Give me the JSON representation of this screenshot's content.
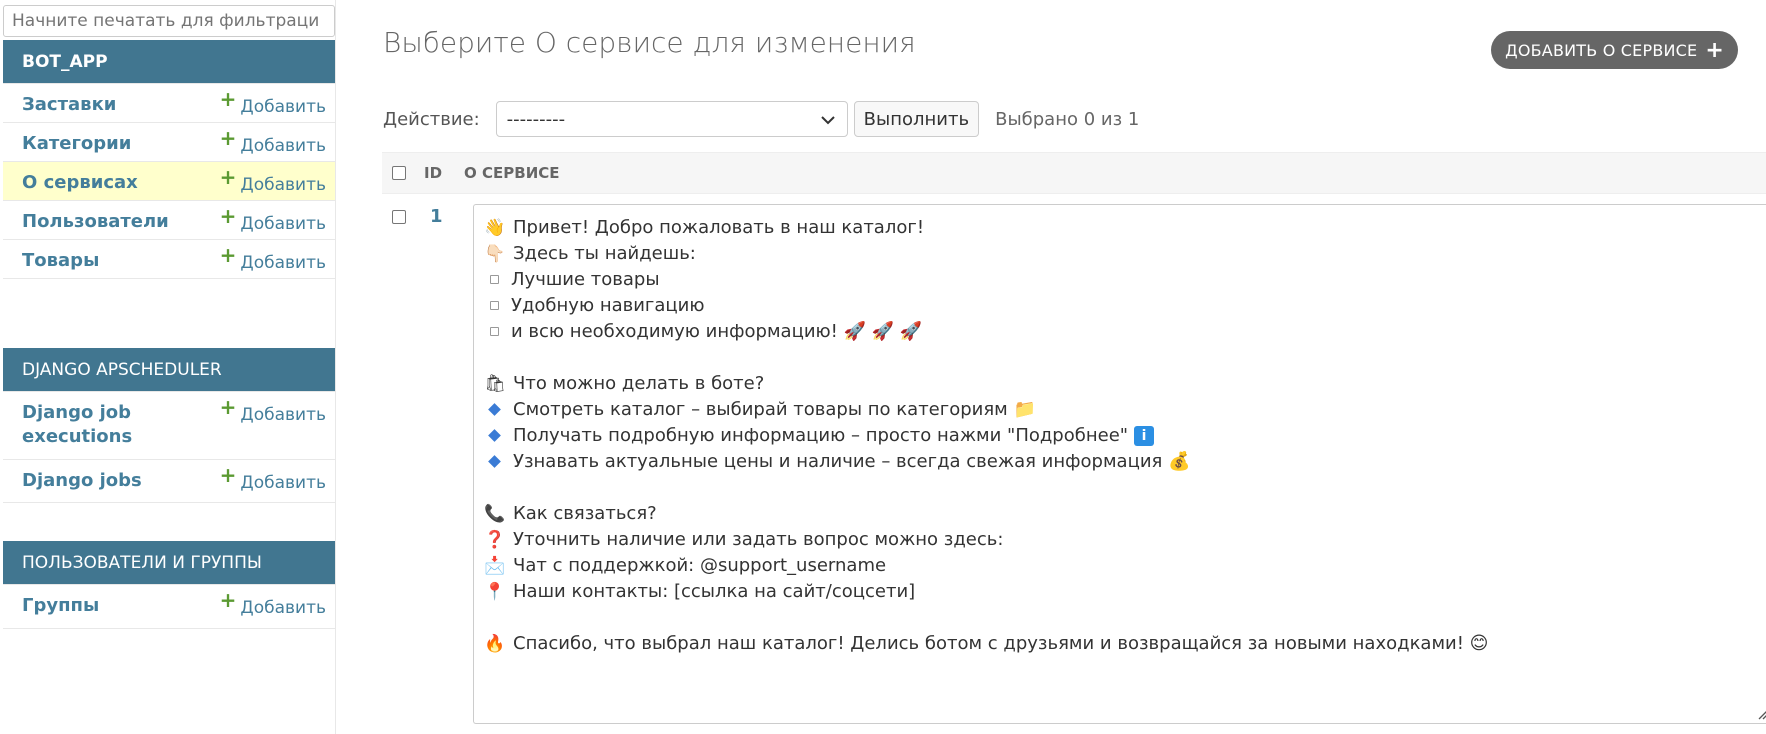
{
  "sidebar": {
    "filter_placeholder": "Начните печатать для фильтраци",
    "modules": [
      {
        "title": "BOT_APP",
        "rows": [
          {
            "name": "Заставки",
            "add": "Добавить"
          },
          {
            "name": "Категории",
            "add": "Добавить"
          },
          {
            "name": "О сервисах",
            "add": "Добавить",
            "current": true
          },
          {
            "name": "Пользователи",
            "add": "Добавить"
          },
          {
            "name": "Товары",
            "add": "Добавить"
          }
        ]
      },
      {
        "title": "DJANGO APSCHEDULER",
        "rows": [
          {
            "name": "Django job executions",
            "add": "Добавить"
          },
          {
            "name": "Django jobs",
            "add": "Добавить"
          }
        ]
      },
      {
        "title": "ПОЛЬЗОВАТЕЛИ И ГРУППЫ",
        "rows": [
          {
            "name": "Группы",
            "add": "Добавить"
          }
        ]
      }
    ]
  },
  "main": {
    "title": "Выберите О сервисе для изменения",
    "add_button": "ДОБАВИТЬ О СЕРВИСЕ",
    "actions": {
      "label": "Действие:",
      "selected_option": "---------",
      "go_label": "Выполнить",
      "selected_count": "Выбрано 0 из 1"
    },
    "table": {
      "columns": [
        "ID",
        "О СЕРВИСЕ"
      ],
      "rows": [
        {
          "id": "1",
          "about_lines": [
            {
              "icon": "👋",
              "text": "Привет! Добро пожаловать в наш каталог!"
            },
            {
              "icon": "👇🏻",
              "text": "Здесь ты найдешь:"
            },
            {
              "icon": "square",
              "text": "Лучшие товары"
            },
            {
              "icon": "square",
              "text": "Удобную навигацию"
            },
            {
              "icon": "square",
              "text": "и всю необходимую информацию! 🚀 🚀 🚀"
            },
            {
              "icon": "",
              "text": ""
            },
            {
              "icon": "🛍",
              "text": "Что можно делать в боте?"
            },
            {
              "icon": "diamond",
              "text": "Смотреть каталог – выбирай товары по категориям 📁"
            },
            {
              "icon": "diamond",
              "text": "Получать подробную информацию – просто нажми \"Подробнее\"",
              "badge": "i"
            },
            {
              "icon": "diamond",
              "text": "Узнавать актуальные цены и наличие – всегда свежая информация 💰"
            },
            {
              "icon": "",
              "text": ""
            },
            {
              "icon": "📞",
              "text": "Как связаться?"
            },
            {
              "icon": "❓",
              "text": "Уточнить наличие или задать вопрос можно здесь:"
            },
            {
              "icon": "📩",
              "text": "Чат с поддержкой: @support_username"
            },
            {
              "icon": "📍",
              "text": "Наши контакты: [ссылка на сайт/соцсети]"
            },
            {
              "icon": "",
              "text": ""
            },
            {
              "icon": "🔥",
              "text": "Спасибо, что выбрал наш каталог! Делись ботом с друзьями и возвращайся за новыми находками! 😊"
            }
          ]
        }
      ]
    }
  },
  "colors": {
    "module_header": "#417690",
    "link": "#447e9b",
    "add_plus": "#5b9a32",
    "current_row": "#ffffcc",
    "add_button_bg": "#666666"
  }
}
